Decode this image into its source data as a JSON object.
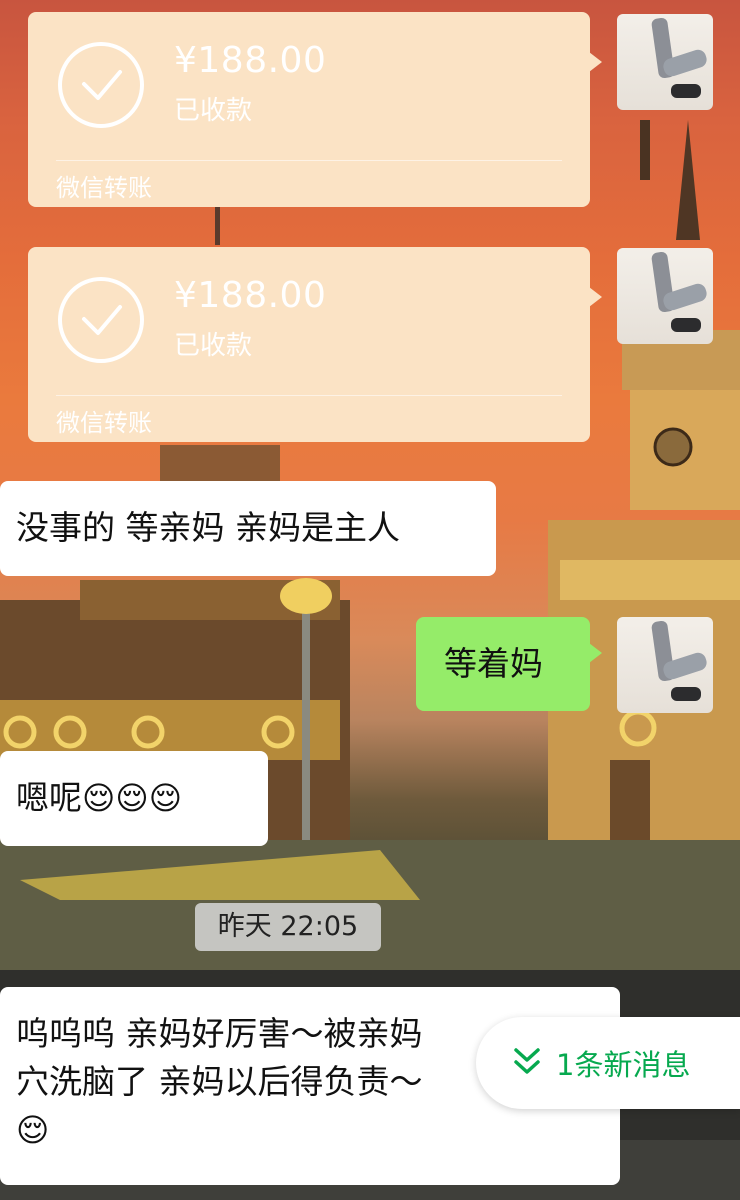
{
  "transfers": [
    {
      "amount": "¥188.00",
      "status": "已收款",
      "caption": "微信转账"
    },
    {
      "amount": "¥188.00",
      "status": "已收款",
      "caption": "微信转账"
    }
  ],
  "messages": [
    {
      "text": "没事的 等亲妈 亲妈是主人"
    },
    {
      "text": "等着妈"
    },
    {
      "text": "嗯呢",
      "emoji": "😌😌😌"
    },
    {
      "text_line1": "呜呜呜 亲妈好厉害～被亲妈",
      "text_line2": "穴洗脑了 亲妈以后得负责～",
      "emoji": "😌"
    }
  ],
  "timestamp": "昨天 22:05",
  "new_messages": {
    "label": "1条新消息",
    "icon": "double-chevron-down-icon",
    "color": "#07a94f"
  },
  "colors": {
    "transfer_bg": "#fbe3c5",
    "my_bubble": "#95ec69",
    "their_bubble": "#ffffff"
  }
}
